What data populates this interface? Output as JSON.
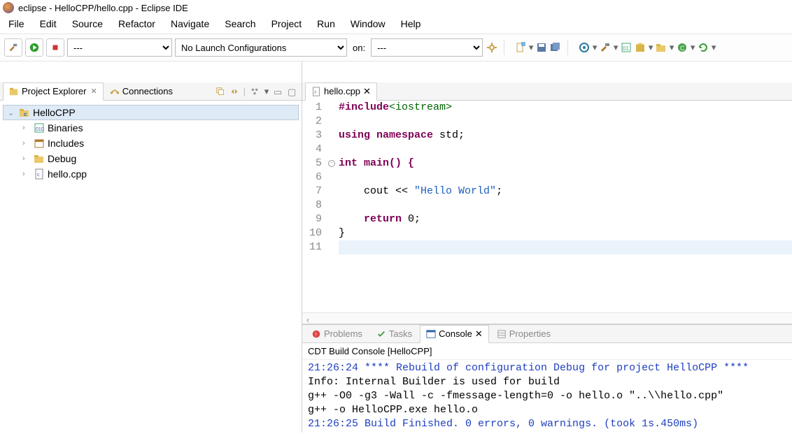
{
  "title": "eclipse - HelloCPP/hello.cpp - Eclipse IDE",
  "menubar": [
    "File",
    "Edit",
    "Source",
    "Refactor",
    "Navigate",
    "Search",
    "Project",
    "Run",
    "Window",
    "Help"
  ],
  "toolbar": {
    "config_selector": "---",
    "launch_selector": "No Launch Configurations",
    "on_label": "on:",
    "target_selector": "---"
  },
  "left_pane": {
    "tab1": "Project Explorer",
    "tab2": "Connections",
    "tree": {
      "project": "HelloCPP",
      "children": [
        "Binaries",
        "Includes",
        "Debug",
        "hello.cpp"
      ]
    }
  },
  "editor": {
    "tab": "hello.cpp",
    "lines": [
      {
        "n": 1
      },
      {
        "n": 2
      },
      {
        "n": 3
      },
      {
        "n": 4
      },
      {
        "n": 5
      },
      {
        "n": 6
      },
      {
        "n": 7
      },
      {
        "n": 8
      },
      {
        "n": 9
      },
      {
        "n": 10
      },
      {
        "n": 11
      }
    ],
    "src": {
      "l1_kw": "#include",
      "l1_inc": "<iostream>",
      "l3_kw1": "using",
      "l3_kw2": "namespace",
      "l3_id": " std;",
      "l5_kw": "int",
      "l5_fn": " main() {",
      "l7_pre": "    cout << ",
      "l7_str": "\"Hello World\"",
      "l7_post": ";",
      "l9_pre": "    ",
      "l9_kw": "return",
      "l9_post": " 0;",
      "l10": "}"
    }
  },
  "bottom": {
    "tabs": [
      "Problems",
      "Tasks",
      "Console",
      "Properties"
    ],
    "console_title": "CDT Build Console [HelloCPP]",
    "lines": [
      {
        "cls": "blue",
        "t": "21:26:24 **** Rebuild of configuration Debug for project HelloCPP ****"
      },
      {
        "cls": "",
        "t": "Info: Internal Builder is used for build"
      },
      {
        "cls": "",
        "t": "g++ -O0 -g3 -Wall -c -fmessage-length=0 -o hello.o \"..\\\\hello.cpp\""
      },
      {
        "cls": "",
        "t": "g++ -o HelloCPP.exe hello.o"
      },
      {
        "cls": "",
        "t": ""
      },
      {
        "cls": "blue",
        "t": "21:26:25 Build Finished. 0 errors, 0 warnings. (took 1s.450ms)"
      }
    ]
  }
}
